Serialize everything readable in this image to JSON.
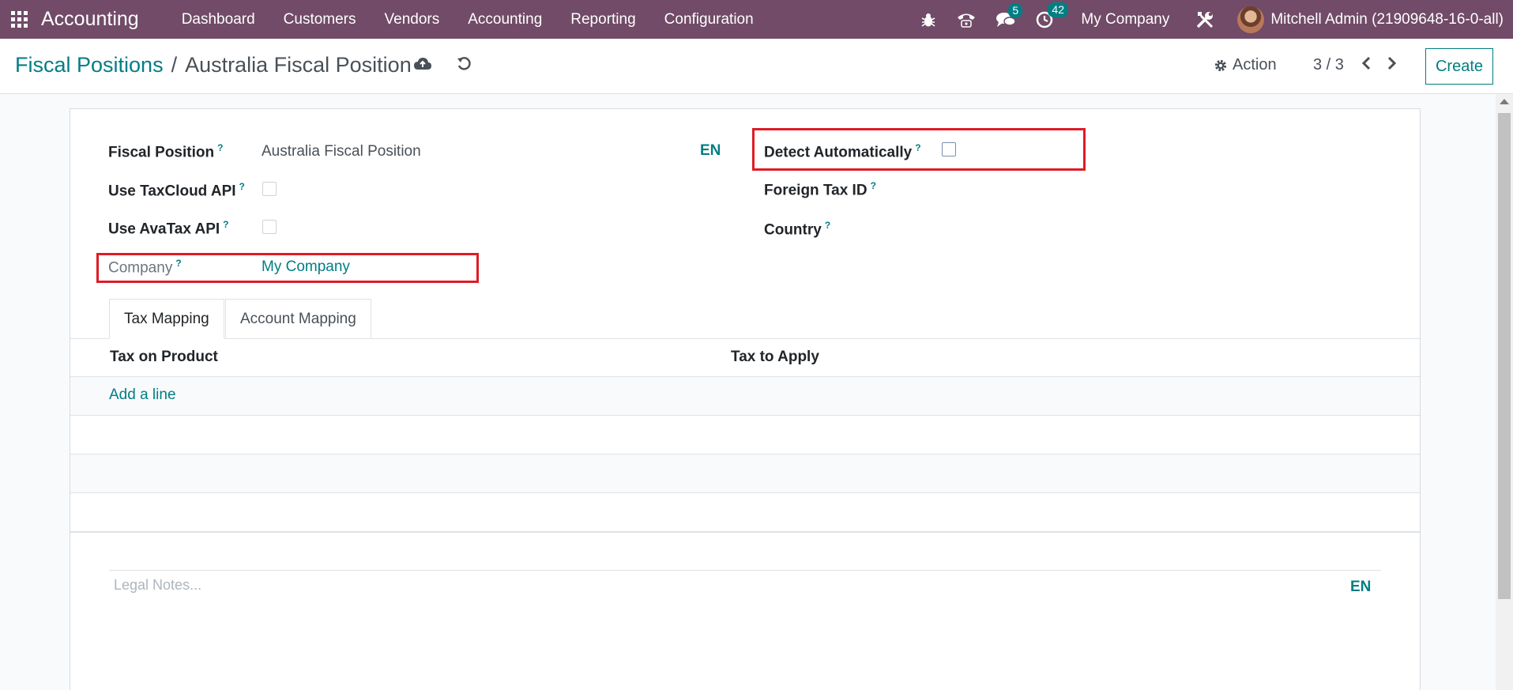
{
  "navbar": {
    "brand": "Accounting",
    "menu": [
      "Dashboard",
      "Customers",
      "Vendors",
      "Accounting",
      "Reporting",
      "Configuration"
    ],
    "messages_count": "5",
    "activities_count": "42",
    "company": "My Company",
    "user": "Mitchell Admin (21909648-16-0-all)",
    "icons": [
      "apps-grid-icon",
      "bug-icon",
      "phone-icon",
      "chat-icon",
      "clock-icon",
      "tools-icon"
    ]
  },
  "breadcrumb": {
    "parent": "Fiscal Positions",
    "separator": "/",
    "current": "Australia Fiscal Position"
  },
  "control": {
    "action_label": "Action",
    "pager": "3 / 3",
    "create_label": "Create"
  },
  "form": {
    "fiscal_position_label": "Fiscal Position",
    "fiscal_position_value": "Australia Fiscal Position",
    "lang_tag": "EN",
    "taxcloud_label": "Use TaxCloud API",
    "taxcloud_checked": false,
    "avatax_label": "Use AvaTax API",
    "avatax_checked": false,
    "company_label": "Company",
    "company_value": "My Company",
    "detect_label": "Detect Automatically",
    "detect_checked": false,
    "foreign_tax_label": "Foreign Tax ID",
    "country_label": "Country",
    "help_mark": "?"
  },
  "tabs": [
    {
      "label": "Tax Mapping",
      "active": true
    },
    {
      "label": "Account Mapping",
      "active": false
    }
  ],
  "table": {
    "columns": [
      "Tax on Product",
      "Tax to Apply"
    ],
    "add_line": "Add a line"
  },
  "notes": {
    "placeholder": "Legal Notes...",
    "lang_tag": "EN"
  },
  "colors": {
    "navbar": "#714b67",
    "accent": "#017e84",
    "highlight": "#e01b24"
  }
}
